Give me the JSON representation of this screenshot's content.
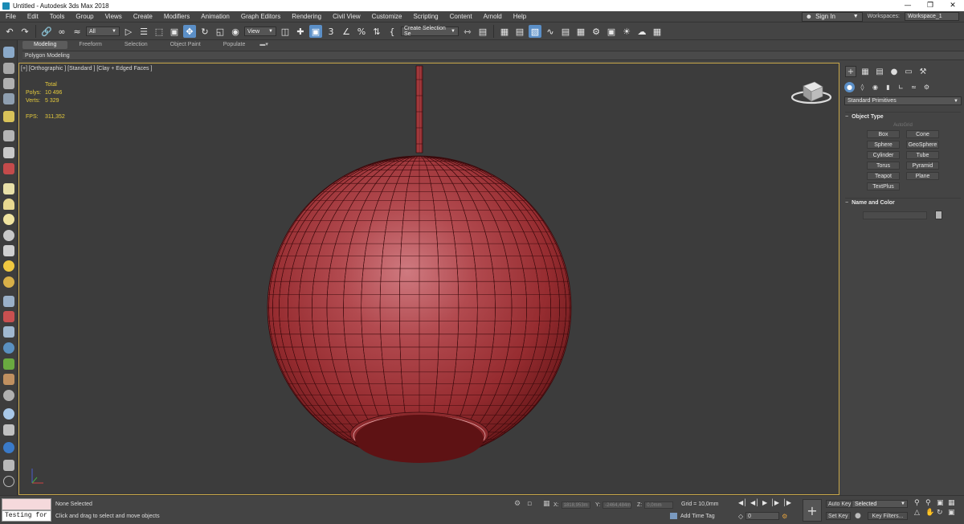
{
  "window": {
    "title": "Untitled - Autodesk 3ds Max 2018",
    "controls": [
      "—",
      "❐",
      "✕"
    ]
  },
  "menu": {
    "items": [
      "File",
      "Edit",
      "Tools",
      "Group",
      "Views",
      "Create",
      "Modifiers",
      "Animation",
      "Graph Editors",
      "Rendering",
      "Civil View",
      "Customize",
      "Scripting",
      "Content",
      "Arnold",
      "Help"
    ],
    "sign_in": "Sign In",
    "workspaces_label": "Workspaces:",
    "workspace_value": "Workspace_1"
  },
  "toolbar": {
    "filter_value": "All",
    "coord_system": "View",
    "selection_set": "Create Selection Se"
  },
  "ribbon": {
    "tabs": [
      "Modeling",
      "Freeform",
      "Selection",
      "Object Paint",
      "Populate"
    ],
    "active_tab": "Modeling",
    "sub_label": "Polygon Modeling"
  },
  "viewport": {
    "label": "[+] [Orthographic ] [Standard ] [Clay + Edged Faces ]",
    "stats": {
      "header": "Total",
      "polys_label": "Polys:",
      "polys_value": "10 496",
      "verts_label": "Verts:",
      "verts_value": "5 329",
      "fps_label": "FPS:",
      "fps_value": "311,352"
    },
    "object_color": "#b8373b",
    "border_color": "#c9a84a"
  },
  "command_panel": {
    "primitives_dropdown": "Standard Primitives",
    "object_type": {
      "header": "Object Type",
      "sign": "−",
      "autogrid": "AutoGrid",
      "buttons": [
        "Box",
        "Cone",
        "Sphere",
        "GeoSphere",
        "Cylinder",
        "Tube",
        "Torus",
        "Pyramid",
        "Teapot",
        "Plane",
        "TextPlus"
      ]
    },
    "name_and_color": {
      "header": "Name and Color",
      "sign": "−"
    }
  },
  "status": {
    "maxscript_text": "Testing for :",
    "selection": "None Selected",
    "prompt": "Click and drag to select and move objects",
    "x_label": "X:",
    "x_value": "1818,953m",
    "y_label": "Y:",
    "y_value": "-2464,484m",
    "z_label": "Z:",
    "z_value": "0,0mm",
    "grid": "Grid = 10,0mm",
    "add_time_tag": "Add Time Tag",
    "frame": "0",
    "auto_key": "Auto Key",
    "set_key": "Set Key",
    "key_mode": "Selected",
    "key_filters": "Key Filters..."
  }
}
